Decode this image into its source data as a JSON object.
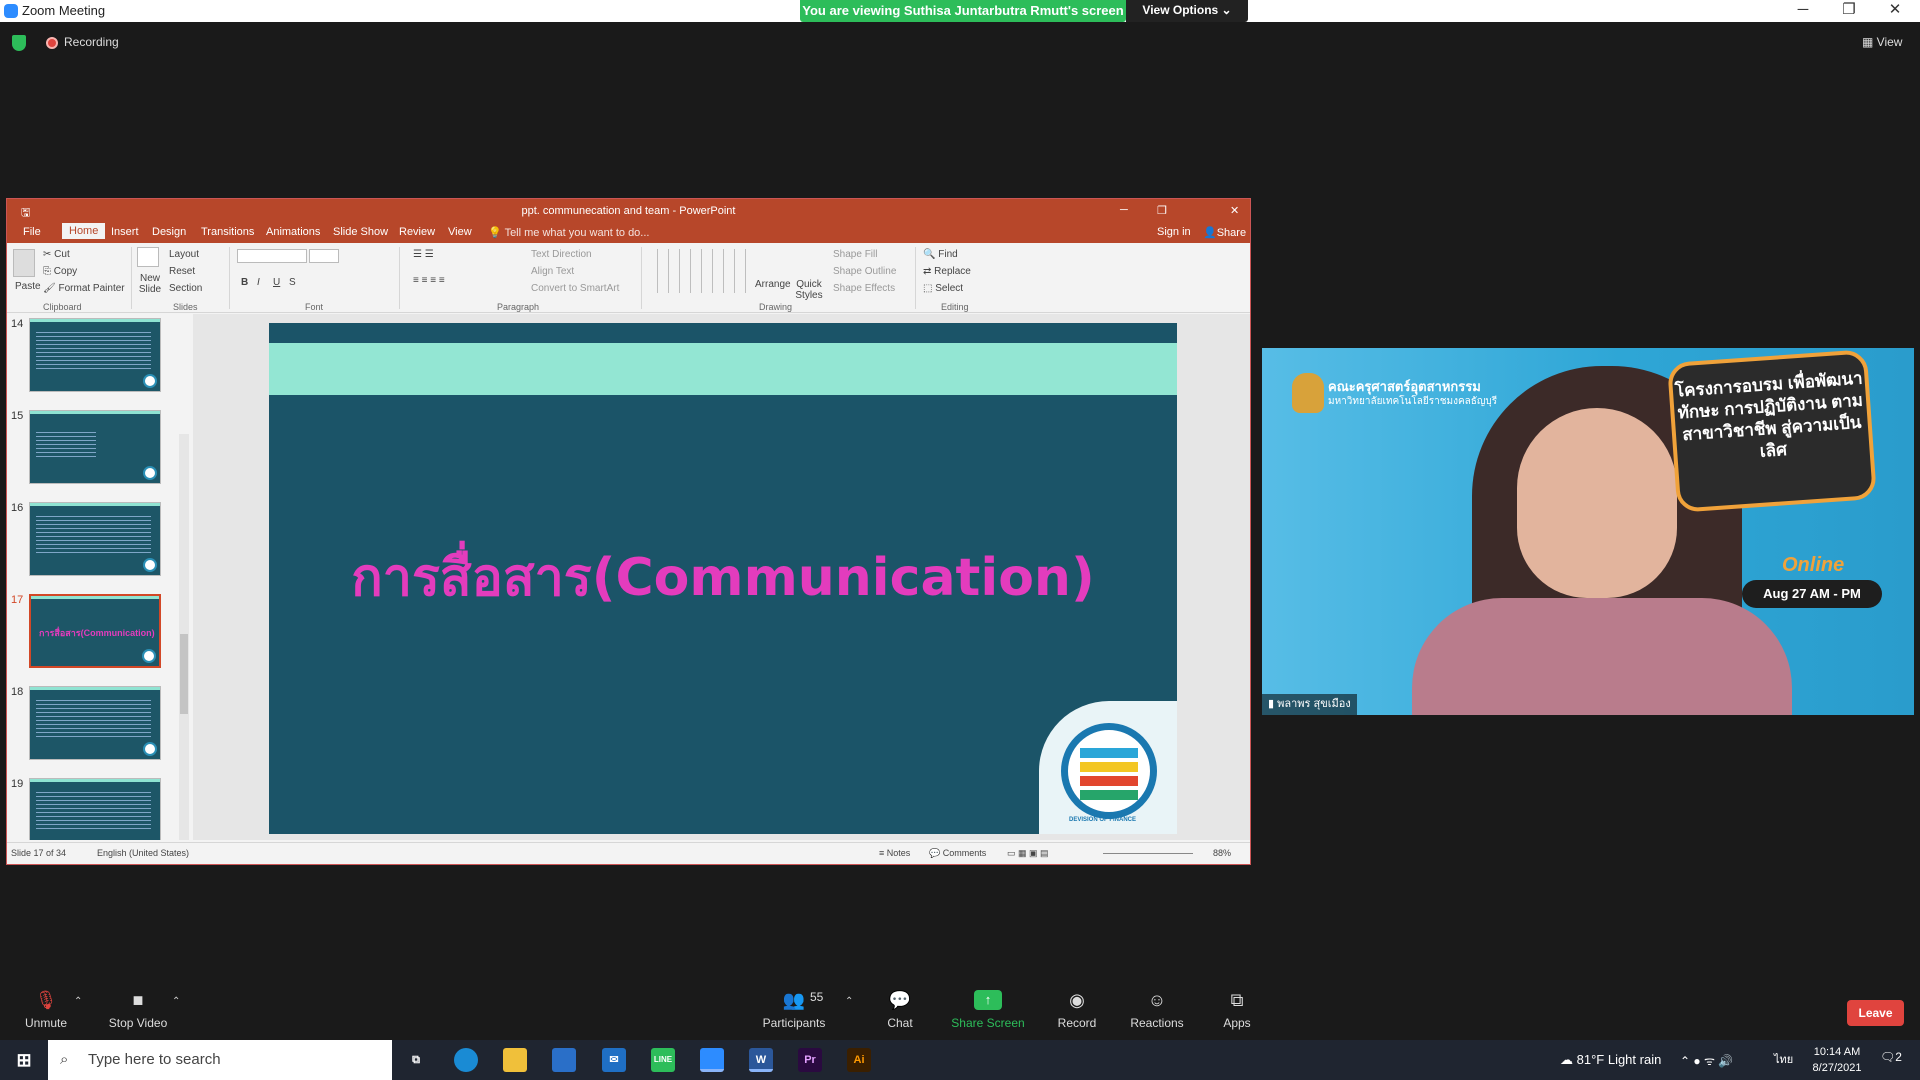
{
  "titlebar": {
    "app_title": "Zoom Meeting",
    "viewing_banner": "You are viewing Suthisa  Juntarbutra Rmutt's screen",
    "view_options": "View Options ⌄"
  },
  "meeting": {
    "recording_label": "Recording",
    "view_label": "View"
  },
  "ppt": {
    "window_title": "ppt. communecation and team - PowerPoint",
    "tabs": [
      "File",
      "Home",
      "Insert",
      "Design",
      "Transitions",
      "Animations",
      "Slide Show",
      "Review",
      "View"
    ],
    "tell_me": "Tell me what you want to do...",
    "sign_in": "Sign in",
    "share": "Share",
    "ribbon": {
      "clipboard": {
        "paste": "Paste",
        "cut": "Cut",
        "copy": "Copy",
        "format_painter": "Format Painter",
        "group": "Clipboard"
      },
      "slides": {
        "new_slide": "New Slide",
        "layout": "Layout",
        "reset": "Reset",
        "section": "Section",
        "group": "Slides"
      },
      "font_group": "Font",
      "paragraph": {
        "text_direction": "Text Direction",
        "align_text": "Align Text",
        "smartart": "Convert to SmartArt",
        "group": "Paragraph"
      },
      "drawing": {
        "arrange": "Arrange",
        "quick_styles": "Quick Styles",
        "shape_fill": "Shape Fill",
        "shape_outline": "Shape Outline",
        "shape_effects": "Shape Effects",
        "group": "Drawing"
      },
      "editing": {
        "find": "Find",
        "replace": "Replace",
        "select": "Select",
        "group": "Editing"
      }
    },
    "thumbnails": [
      {
        "num": "14",
        "label": "\"LEADERSHIP & TEAM\""
      },
      {
        "num": "15",
        "label": "\"LEADERSHIP & TEAM\""
      },
      {
        "num": "16",
        "label": "การทำงานเป็นทีม (Team work)"
      },
      {
        "num": "17",
        "label": "การสื่อสาร(Communication)"
      },
      {
        "num": "18",
        "label": "การสื่อสาร(Communication)"
      },
      {
        "num": "19",
        "label": "การสื่อสารอย่างมีประสิทธิภาพ"
      }
    ],
    "slide_title": "การสื่อสาร(Communication)",
    "logo_text": "DEVISION OF FINANCE",
    "status": {
      "slide_info": "Slide 17 of 34",
      "language": "English (United States)",
      "notes": "Notes",
      "comments": "Comments",
      "zoom": "88%"
    }
  },
  "video": {
    "faculty": "คณะครุศาสตร์อุตสาหกรรม",
    "university": "มหาวิทยาลัยเทคโนโลยีราชมงคลธัญบุรี",
    "banner": "โครงการอบรม เพื่อพัฒนาทักษะ การปฏิบัติงาน ตามสาขาวิชาชีพ สู่ความเป็นเลิศ",
    "online": "Online",
    "date_badge": "Aug 27 AM - PM",
    "participant_name": "พลาพร สุขเมือง"
  },
  "toolbar": {
    "unmute": "Unmute",
    "stop_video": "Stop Video",
    "participants": "Participants",
    "participant_count": "55",
    "chat": "Chat",
    "share_screen": "Share Screen",
    "record": "Record",
    "reactions": "Reactions",
    "apps": "Apps",
    "leave": "Leave"
  },
  "taskbar": {
    "search_placeholder": "Type here to search",
    "weather": "81°F  Light rain",
    "lang": "ไทย",
    "time": "10:14 AM",
    "date": "8/27/2021",
    "notifications": "2"
  },
  "colors": {
    "ppt_accent": "#b7472a",
    "slide_bg": "#1b5468",
    "slide_title": "#e33cbd",
    "zoom_green": "#2dbd5a",
    "leave_red": "#e0443e"
  }
}
